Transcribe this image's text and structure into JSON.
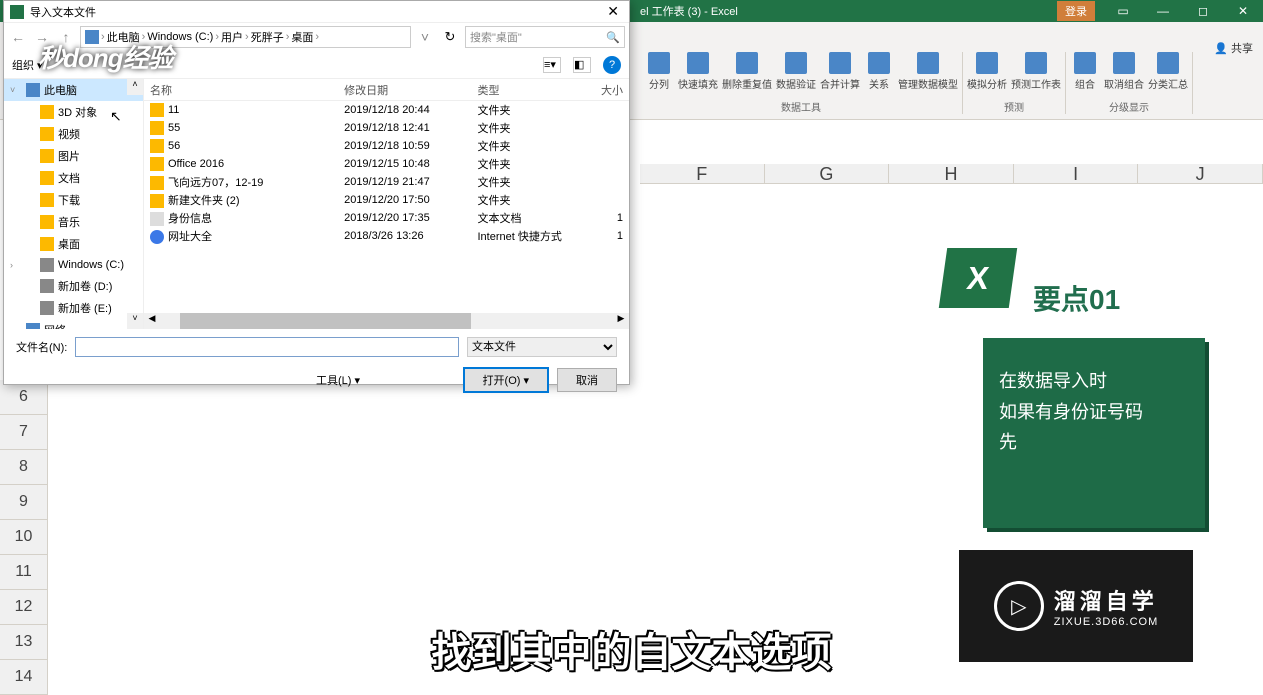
{
  "excel": {
    "title": "el 工作表 (3) - Excel",
    "login": "登录",
    "share": "共享",
    "ribbon_groups": [
      {
        "label": "数据工具",
        "buttons": [
          "分列",
          "快速填充",
          "删除重复值",
          "数据验证",
          "合并计算",
          "关系",
          "管理数据模型"
        ]
      },
      {
        "label": "预测",
        "buttons": [
          "模拟分析",
          "预测工作表"
        ]
      },
      {
        "label": "分级显示",
        "buttons": [
          "组合",
          "取消组合",
          "分类汇总"
        ]
      }
    ],
    "cols": [
      "F",
      "G",
      "H",
      "I",
      "J"
    ],
    "rows": [
      "6",
      "7",
      "8",
      "9",
      "10",
      "11",
      "12",
      "13",
      "14"
    ]
  },
  "dialog": {
    "title": "导入文本文件",
    "breadcrumb": [
      "此电脑",
      "Windows (C:)",
      "用户",
      "死胖子",
      "桌面"
    ],
    "search_placeholder": "搜索\"桌面\"",
    "organize": "组织 ▾",
    "tree": [
      {
        "label": "此电脑",
        "icon": "pc",
        "selected": true,
        "expand": "˅"
      },
      {
        "label": "3D 对象",
        "icon": "folder",
        "indent": true
      },
      {
        "label": "视频",
        "icon": "folder",
        "indent": true
      },
      {
        "label": "图片",
        "icon": "folder",
        "indent": true
      },
      {
        "label": "文档",
        "icon": "folder",
        "indent": true
      },
      {
        "label": "下载",
        "icon": "folder",
        "indent": true
      },
      {
        "label": "音乐",
        "icon": "folder",
        "indent": true
      },
      {
        "label": "桌面",
        "icon": "folder",
        "indent": true
      },
      {
        "label": "Windows (C:)",
        "icon": "disk",
        "indent": true,
        "expand": "›"
      },
      {
        "label": "新加卷 (D:)",
        "icon": "disk",
        "indent": true
      },
      {
        "label": "新加卷 (E:)",
        "icon": "disk",
        "indent": true
      },
      {
        "label": "网络",
        "icon": "pc"
      }
    ],
    "columns": {
      "name": "名称",
      "date": "修改日期",
      "type": "类型",
      "size": "大小"
    },
    "files": [
      {
        "name": "11",
        "date": "2019/12/18 20:44",
        "type": "文件夹",
        "size": "",
        "icon": "folder"
      },
      {
        "name": "55",
        "date": "2019/12/18 12:41",
        "type": "文件夹",
        "size": "",
        "icon": "folder"
      },
      {
        "name": "56",
        "date": "2019/12/18 10:59",
        "type": "文件夹",
        "size": "",
        "icon": "folder"
      },
      {
        "name": "Office 2016",
        "date": "2019/12/15 10:48",
        "type": "文件夹",
        "size": "",
        "icon": "folder"
      },
      {
        "name": "飞向远方07，12-19",
        "date": "2019/12/19 21:47",
        "type": "文件夹",
        "size": "",
        "icon": "folder"
      },
      {
        "name": "新建文件夹 (2)",
        "date": "2019/12/20 17:50",
        "type": "文件夹",
        "size": "",
        "icon": "folder"
      },
      {
        "name": "身份信息",
        "date": "2019/12/20 17:35",
        "type": "文本文档",
        "size": "1",
        "icon": "doc"
      },
      {
        "name": "网址大全",
        "date": "2018/3/26 13:26",
        "type": "Internet 快捷方式",
        "size": "1",
        "icon": "ie"
      }
    ],
    "filename_label": "文件名(N):",
    "filter": "文本文件",
    "tools": "工具(L)  ▾",
    "open": "打开(O)",
    "cancel": "取消",
    "help": "?"
  },
  "tip": {
    "title": "要点01",
    "body": "在数据导入时\n如果有身份证号码\n先",
    "excel_icon": "X"
  },
  "caption": "找到其中的自文本选项",
  "zixue": {
    "big": "溜溜自学",
    "small": "ZIXUE.3D66.COM"
  },
  "logo": "秒dong经验"
}
